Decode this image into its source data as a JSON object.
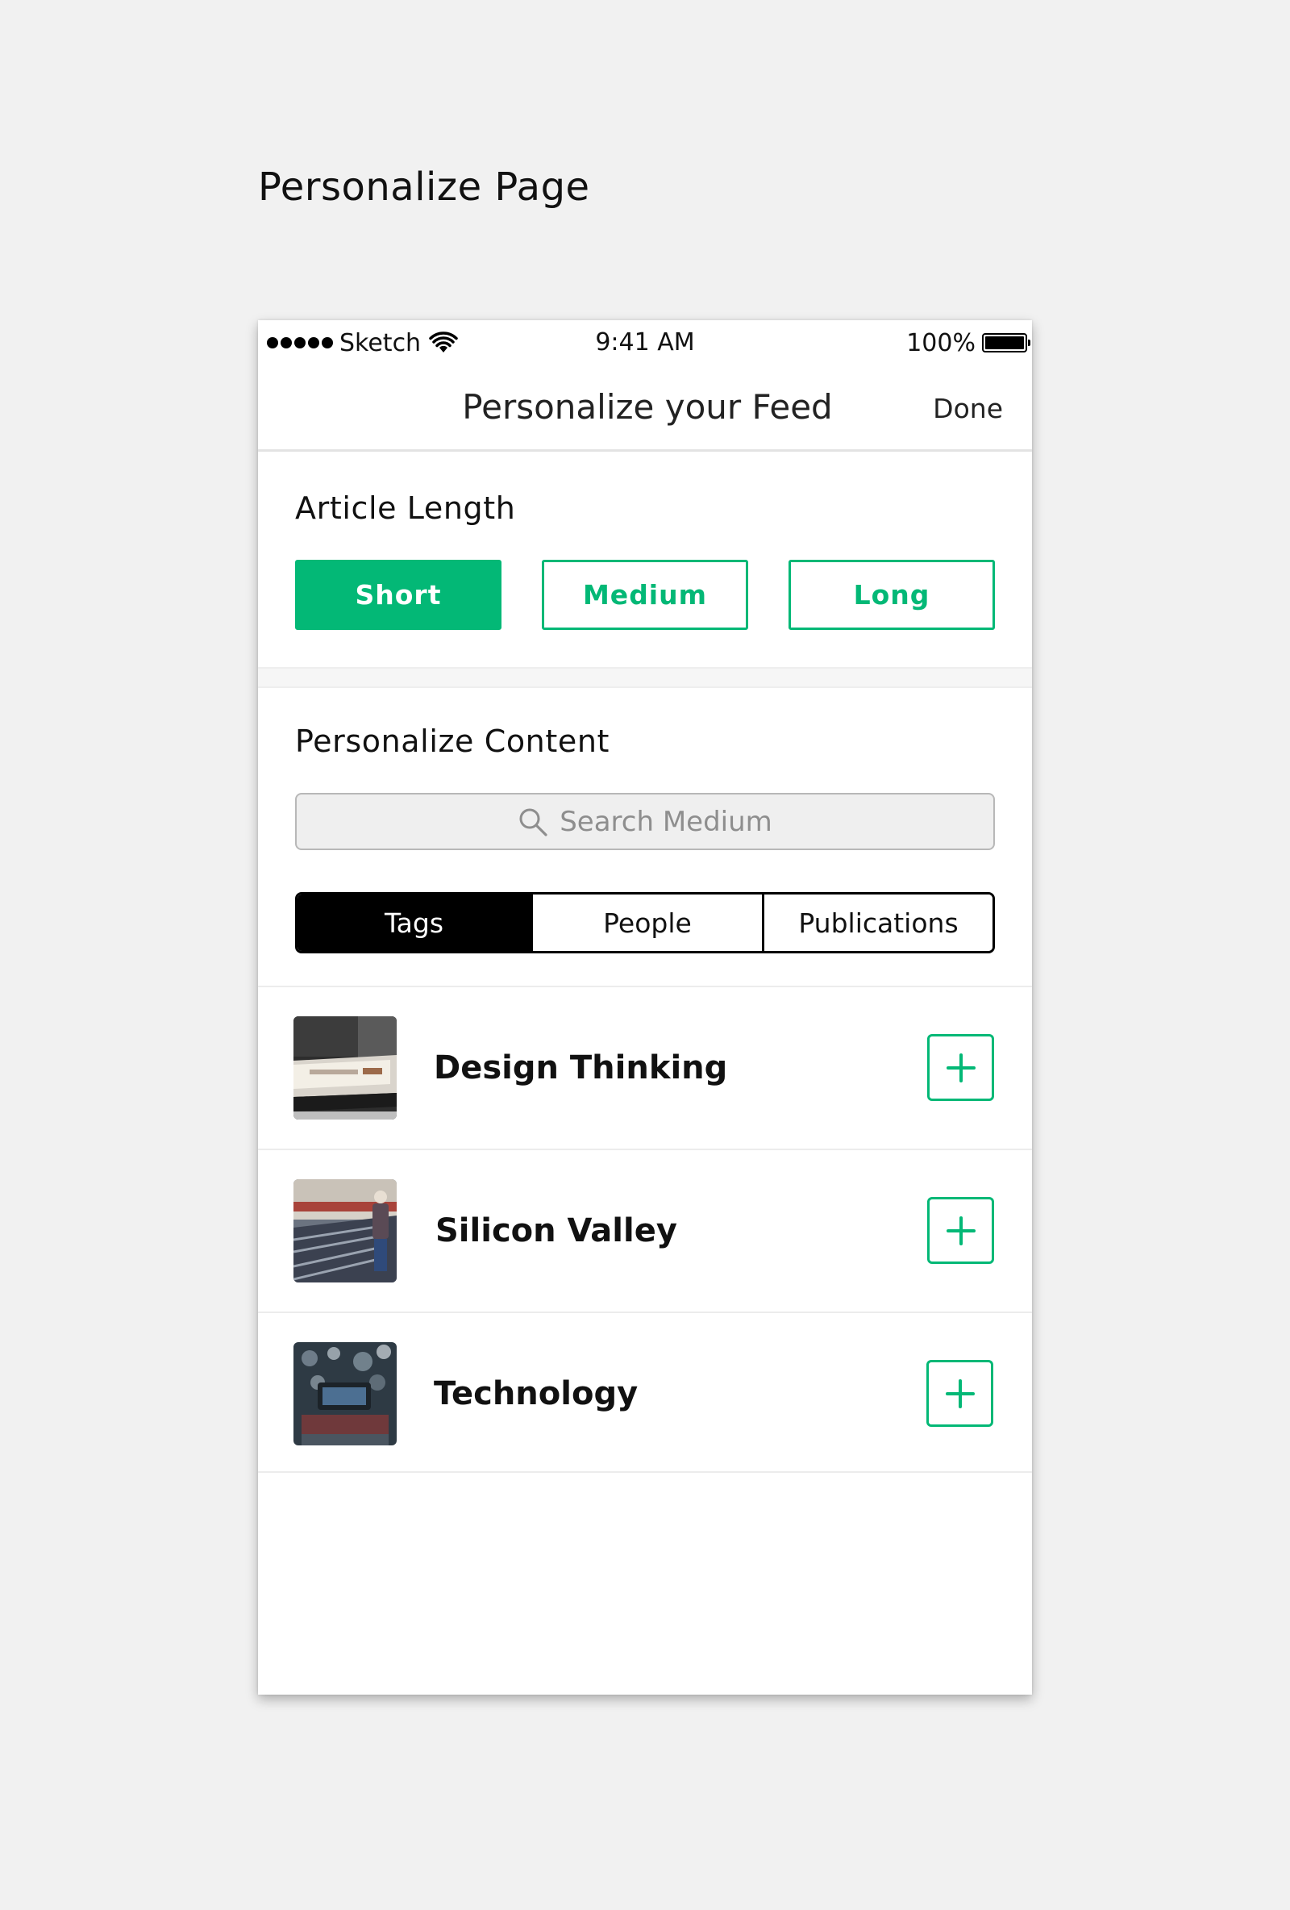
{
  "page_heading": "Personalize Page",
  "status_bar": {
    "carrier": "Sketch",
    "time": "9:41 AM",
    "battery": "100%",
    "battery_level": 1.0
  },
  "nav": {
    "title": "Personalize your Feed",
    "done_label": "Done"
  },
  "article_length": {
    "title": "Article Length",
    "options": [
      "Short",
      "Medium",
      "Long"
    ],
    "selected": "Short"
  },
  "personalize_content": {
    "title": "Personalize Content",
    "search_placeholder": "Search Medium",
    "tabs": [
      "Tags",
      "People",
      "Publications"
    ],
    "selected_tab": "Tags",
    "items": [
      {
        "label": "Design Thinking",
        "icon": "plus-icon"
      },
      {
        "label": "Silicon Valley",
        "icon": "plus-icon"
      },
      {
        "label": "Technology",
        "icon": "plus-icon"
      }
    ]
  },
  "colors": {
    "accent": "#03b876",
    "page_background": "#f1f1f1",
    "card_background": "#ffffff"
  }
}
